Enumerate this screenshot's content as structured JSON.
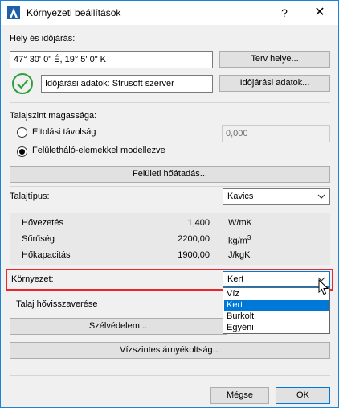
{
  "window": {
    "title": "Környezeti beállítások",
    "help": "?",
    "close": "✕"
  },
  "location": {
    "heading": "Hely és időjárás:",
    "coordinates": "47° 30' 0\" É, 19° 5' 0\" K",
    "site_button": "Terv helye...",
    "weather_source": "Időjárási adatok: Strusoft szerver",
    "weather_button": "Időjárási adatok...",
    "status_icon": "check-circle-icon",
    "status_color": "#2e9e3a"
  },
  "ground_level": {
    "heading": "Talajszint magassága:",
    "option_offset": "Eltolási távolság",
    "offset_value": "0,000",
    "option_mesh": "Felületháló-elemekkel modellezve",
    "selected": "mesh"
  },
  "surface_heat_button": "Felületi hőátadás...",
  "soil": {
    "label": "Talajtípus:",
    "value": "Kavics",
    "properties": [
      {
        "name": "Hővezetés",
        "value": "1,400",
        "unit": "W/mK"
      },
      {
        "name": "Sűrűség",
        "value": "2200,00",
        "unit_base": "kg/m",
        "unit_sup": "3"
      },
      {
        "name": "Hőkapacitás",
        "value": "1900,00",
        "unit": "J/kgK"
      }
    ]
  },
  "environment": {
    "label": "Környezet:",
    "value": "Kert",
    "options": [
      "Víz",
      "Kert",
      "Burkolt",
      "Egyéni"
    ],
    "selected_index": 1,
    "highlight_color": "#e8262c"
  },
  "soil_reflectance_label": "Talaj hővisszaverése",
  "wind_button": "Szélvédelem...",
  "horizontal_shading_button": "Vízszintes árnyékoltság...",
  "footer": {
    "cancel": "Mégse",
    "ok": "OK"
  },
  "accent_color": "#0078d7"
}
